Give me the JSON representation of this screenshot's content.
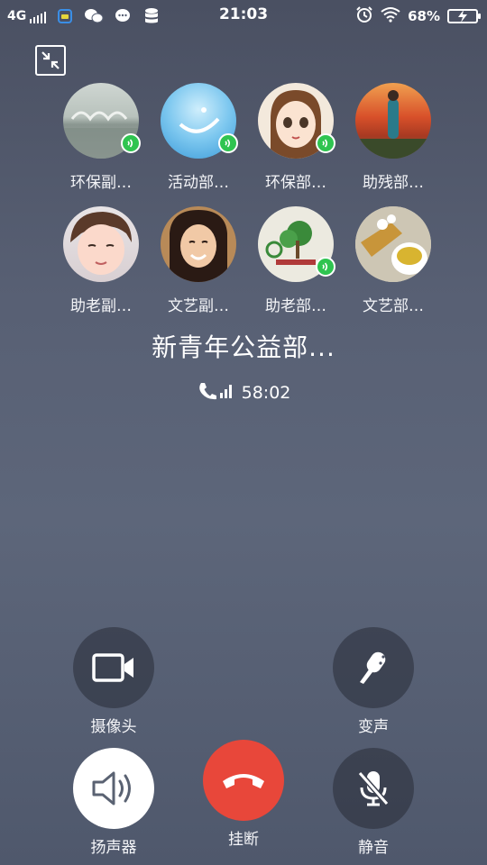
{
  "status_bar": {
    "network": "4G",
    "time": "21:03",
    "battery_percent": "68%",
    "icons": [
      "signal-icon",
      "app-notification-icon",
      "wechat-icon",
      "message-icon",
      "database-icon",
      "alarm-icon",
      "wifi-icon",
      "battery-charging-icon"
    ]
  },
  "participants": [
    {
      "name": "环保副…",
      "speaking": true
    },
    {
      "name": "活动部…",
      "speaking": true
    },
    {
      "name": "环保部…",
      "speaking": true
    },
    {
      "name": "助残部…",
      "speaking": false
    },
    {
      "name": "助老副…",
      "speaking": false
    },
    {
      "name": "文艺副…",
      "speaking": false
    },
    {
      "name": "助老部…",
      "speaking": true
    },
    {
      "name": "文艺部…",
      "speaking": false
    }
  ],
  "call": {
    "group_name": "新青年公益部...",
    "duration": "58:02"
  },
  "controls": {
    "camera_label": "摄像头",
    "voice_changer_label": "变声",
    "speaker_label": "扬声器",
    "hangup_label": "挂断",
    "mute_label": "静音"
  },
  "colors": {
    "accent_green": "#2fc450",
    "hangup_red": "#e8473a"
  }
}
